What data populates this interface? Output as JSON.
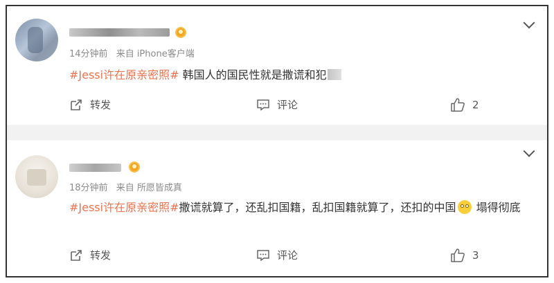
{
  "comments": [
    {
      "time": "14分钟前",
      "source": "来自 iPhone客户端",
      "hashtag": "#Jessi许在原亲密照#",
      "text": " 韩国人的国民性就是撒谎和犯",
      "text_after_emoji": "",
      "actions": {
        "repost": "转发",
        "comment": "评论",
        "like_count": "2"
      }
    },
    {
      "time": "18分钟前",
      "source": "来自 所愿皆成真",
      "hashtag": "#Jessi许在原亲密照#",
      "text": "撒谎就算了，还乱扣国籍，乱扣国籍就算了，还扣的中国",
      "text_after_emoji": " 塌得彻底",
      "actions": {
        "repost": "转发",
        "comment": "评论",
        "like_count": "3"
      }
    }
  ],
  "icons": {
    "repost": "repost-icon",
    "comment": "comment-icon",
    "like": "thumbs-up-icon",
    "more": "chevron-down-icon",
    "badge": "vip-badge-icon",
    "emoji": "rolling-eyes-emoji"
  },
  "colors": {
    "hashtag": "#eb7350",
    "meta": "#8a8a8a",
    "separator": "#f2f2f2",
    "text": "#333333"
  }
}
